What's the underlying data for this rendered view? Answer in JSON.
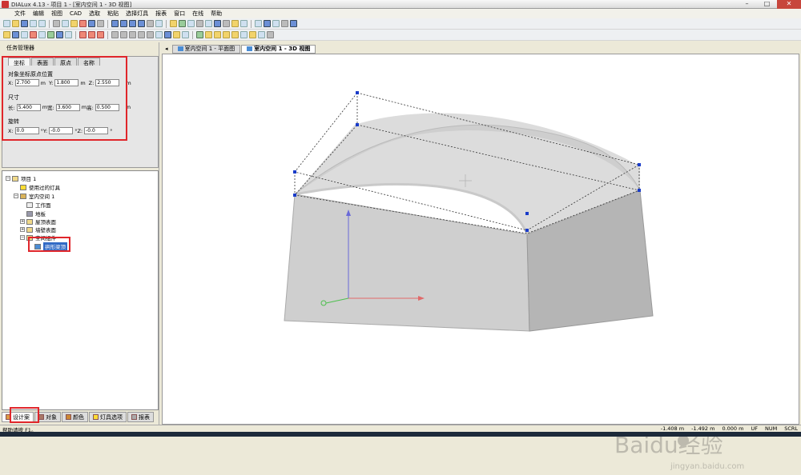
{
  "window": {
    "title": "DIALux 4.13 - 项目 1 - [室内空间 1 - 3D 视图]"
  },
  "menu": [
    "文件",
    "编辑",
    "视图",
    "CAD",
    "选取",
    "粘贴",
    "选择灯具",
    "报表",
    "窗口",
    "在线",
    "帮助"
  ],
  "left_panel": {
    "title": "任务管理器"
  },
  "props": {
    "tabs": [
      "坐标",
      "表面",
      "原点",
      "名称"
    ],
    "pos_title": "对象坐标原点位置",
    "x_label": "X:",
    "x_val": "2.700",
    "y_label": "Y:",
    "y_val": "1.800",
    "z_label": "Z:",
    "z_val": "2.550",
    "unit": "m",
    "size_title": "尺寸",
    "len_label": "长:",
    "len_val": "5.400",
    "wid_label": "宽:",
    "wid_val": "3.600",
    "ht_label": "高:",
    "ht_val": "0.500",
    "rot_title": "旋转",
    "rx_val": "0.0",
    "ry_val": "-0.0",
    "rz_val": "-0.0",
    "deg": "°"
  },
  "tree": {
    "n1": "项目 1",
    "n2": "使用过的灯具",
    "n3": "室内空间 1",
    "n4": "工作面",
    "n5": "地板",
    "n6": "屋顶表面",
    "n7": "墙壁表面",
    "n8": "空间组件",
    "n9": "拱形梁顶"
  },
  "bottom_tabs": [
    "设计案",
    "对象",
    "颜色",
    "灯具选项",
    "报表"
  ],
  "view_tabs": [
    "室内空间 1 - 平面图",
    "室内空间 1 - 3D 视图"
  ],
  "status": {
    "help": "帮助请按 F1。",
    "x": "-1.408 m",
    "y": "-1.492 m",
    "z": "0.000 m",
    "uf": "UF",
    "num": "NUM",
    "scrl": "SCRL"
  },
  "watermark": {
    "text": "Baidu经验",
    "url": "jingyan.baidu.com"
  },
  "colors": {
    "highlight": "#e0262b",
    "selection": "#316ac5"
  }
}
